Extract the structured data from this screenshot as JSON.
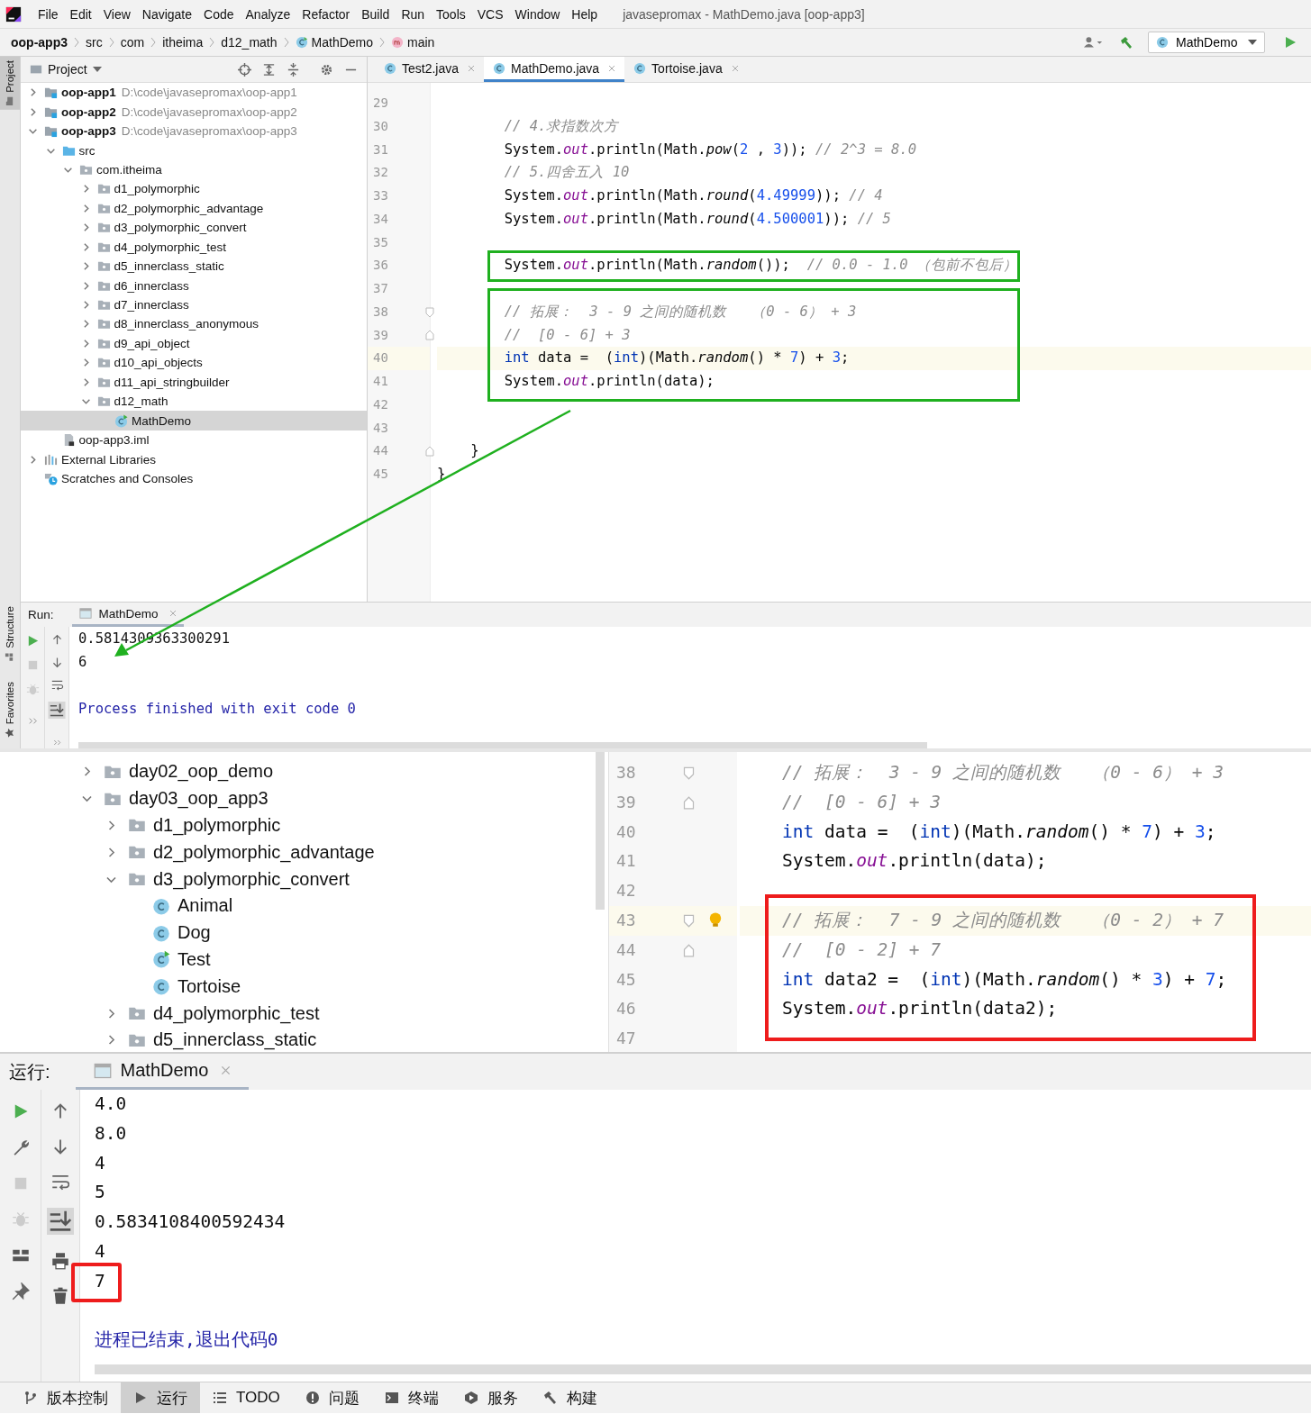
{
  "menubar": {
    "items": [
      "File",
      "Edit",
      "View",
      "Navigate",
      "Code",
      "Analyze",
      "Refactor",
      "Build",
      "Run",
      "Tools",
      "VCS",
      "Window",
      "Help"
    ],
    "title": "javasepromax - MathDemo.java [oop-app3]"
  },
  "breadcrumbs": [
    {
      "label": "oop-app3",
      "kind": "module"
    },
    {
      "label": "src",
      "kind": "plain"
    },
    {
      "label": "com",
      "kind": "plain"
    },
    {
      "label": "itheima",
      "kind": "plain"
    },
    {
      "label": "d12_math",
      "kind": "plain"
    },
    {
      "label": "MathDemo",
      "kind": "class"
    },
    {
      "label": "main",
      "kind": "method"
    }
  ],
  "run_config": "MathDemo",
  "left_strip": {
    "project": "Project",
    "structure": "Structure",
    "favorites": "Favorites"
  },
  "project_panel": {
    "title": "Project",
    "tree": [
      {
        "label": "oop-app1",
        "path": "D:\\code\\javasepromax\\oop-app1",
        "kind": "module",
        "expanded": false,
        "selected": false
      },
      {
        "label": "oop-app2",
        "path": "D:\\code\\javasepromax\\oop-app2",
        "kind": "module",
        "expanded": false,
        "selected": false
      },
      {
        "label": "oop-app3",
        "path": "D:\\code\\javasepromax\\oop-app3",
        "kind": "module",
        "expanded": true,
        "selected": false,
        "children": [
          {
            "label": "src",
            "kind": "source",
            "expanded": true,
            "selected": false,
            "children": [
              {
                "label": "com.itheima",
                "kind": "package",
                "expanded": true,
                "selected": false,
                "children": [
                  {
                    "label": "d1_polymorphic",
                    "kind": "package",
                    "expanded": false,
                    "selected": false
                  },
                  {
                    "label": "d2_polymorphic_advantage",
                    "kind": "package",
                    "expanded": false,
                    "selected": false
                  },
                  {
                    "label": "d3_polymorphic_convert",
                    "kind": "package",
                    "expanded": false,
                    "selected": false
                  },
                  {
                    "label": "d4_polymorphic_test",
                    "kind": "package",
                    "expanded": false,
                    "selected": false
                  },
                  {
                    "label": "d5_innerclass_static",
                    "kind": "package",
                    "expanded": false,
                    "selected": false
                  },
                  {
                    "label": "d6_innerclass",
                    "kind": "package",
                    "expanded": false,
                    "selected": false
                  },
                  {
                    "label": "d7_innerclass",
                    "kind": "package",
                    "expanded": false,
                    "selected": false
                  },
                  {
                    "label": "d8_innerclass_anonymous",
                    "kind": "package",
                    "expanded": false,
                    "selected": false
                  },
                  {
                    "label": "d9_api_object",
                    "kind": "package",
                    "expanded": false,
                    "selected": false
                  },
                  {
                    "label": "d10_api_objects",
                    "kind": "package",
                    "expanded": false,
                    "selected": false
                  },
                  {
                    "label": "d11_api_stringbuilder",
                    "kind": "package",
                    "expanded": false,
                    "selected": false
                  },
                  {
                    "label": "d12_math",
                    "kind": "package",
                    "expanded": true,
                    "selected": false,
                    "children": [
                      {
                        "label": "MathDemo",
                        "kind": "class_main",
                        "selected": true
                      }
                    ]
                  }
                ]
              }
            ]
          },
          {
            "label": "oop-app3.iml",
            "kind": "file",
            "selected": false
          }
        ]
      },
      {
        "label": "External Libraries",
        "kind": "library",
        "expanded": false,
        "selected": false
      },
      {
        "label": "Scratches and Consoles",
        "kind": "scratches",
        "selected": false
      }
    ]
  },
  "editor": {
    "tabs": [
      {
        "label": "Test2.java",
        "selected": false
      },
      {
        "label": "MathDemo.java",
        "selected": true
      },
      {
        "label": "Tortoise.java",
        "selected": false
      }
    ],
    "blocks": [
      {
        "boxed": false,
        "lines": [
          {
            "number": "29"
          },
          {
            "number": "30",
            "tokens": [
              {
                "kind": "comment",
                "text": "        // 4.求指数次方"
              }
            ]
          },
          {
            "number": "31",
            "tokens": [
              {
                "kind": "plain",
                "text": "        System."
              },
              {
                "kind": "field",
                "text": "out"
              },
              {
                "kind": "plain",
                "text": ".println(Math."
              },
              {
                "kind": "method",
                "text": "pow"
              },
              {
                "kind": "plain",
                "text": "("
              },
              {
                "kind": "number",
                "text": "2"
              },
              {
                "kind": "plain",
                "text": " , "
              },
              {
                "kind": "number",
                "text": "3"
              },
              {
                "kind": "plain",
                "text": ")); "
              },
              {
                "kind": "comment",
                "text": "// 2^3 = 8.0"
              }
            ]
          },
          {
            "number": "32",
            "tokens": [
              {
                "kind": "comment",
                "text": "        // 5.四舍五入 10"
              }
            ]
          },
          {
            "number": "33",
            "tokens": [
              {
                "kind": "plain",
                "text": "        System."
              },
              {
                "kind": "field",
                "text": "out"
              },
              {
                "kind": "plain",
                "text": ".println(Math."
              },
              {
                "kind": "method",
                "text": "round"
              },
              {
                "kind": "plain",
                "text": "("
              },
              {
                "kind": "number",
                "text": "4.49999"
              },
              {
                "kind": "plain",
                "text": ")); "
              },
              {
                "kind": "comment",
                "text": "// 4"
              }
            ]
          },
          {
            "number": "34",
            "tokens": [
              {
                "kind": "plain",
                "text": "        System."
              },
              {
                "kind": "field",
                "text": "out"
              },
              {
                "kind": "plain",
                "text": ".println(Math."
              },
              {
                "kind": "method",
                "text": "round"
              },
              {
                "kind": "plain",
                "text": "("
              },
              {
                "kind": "number",
                "text": "4.500001"
              },
              {
                "kind": "plain",
                "text": ")); "
              },
              {
                "kind": "comment",
                "text": "// 5"
              }
            ]
          },
          {
            "number": "35"
          }
        ]
      },
      {
        "boxed": true,
        "lines": [
          {
            "number": "36",
            "tokens": [
              {
                "kind": "plain",
                "text": "        System."
              },
              {
                "kind": "field",
                "text": "out"
              },
              {
                "kind": "plain",
                "text": ".println(Math."
              },
              {
                "kind": "method",
                "text": "random"
              },
              {
                "kind": "plain",
                "text": "());  "
              },
              {
                "kind": "comment",
                "text": "// 0.0 - 1.0 （包前不包后）"
              }
            ]
          }
        ]
      },
      {
        "boxed": false,
        "lines": [
          {
            "number": "37"
          }
        ]
      },
      {
        "boxed": true,
        "lines": [
          {
            "number": "38",
            "fold_start": true,
            "tokens": [
              {
                "kind": "comment",
                "text": "        // 拓展：  3 - 9 之间的随机数   （0 - 6） + 3"
              }
            ]
          },
          {
            "number": "39",
            "fold_end": true,
            "tokens": [
              {
                "kind": "comment",
                "text": "        //  [0 - 6] + 3"
              }
            ]
          },
          {
            "number": "40",
            "current": true,
            "tokens": [
              {
                "kind": "keyword",
                "text": "        int"
              },
              {
                "kind": "plain",
                "text": " data =  ("
              },
              {
                "kind": "keyword",
                "text": "int"
              },
              {
                "kind": "plain",
                "text": ")(Math."
              },
              {
                "kind": "method",
                "text": "random"
              },
              {
                "kind": "plain",
                "text": "() * "
              },
              {
                "kind": "number",
                "text": "7"
              },
              {
                "kind": "plain",
                "text": ") + "
              },
              {
                "kind": "number",
                "text": "3"
              },
              {
                "kind": "plain",
                "text": ";"
              }
            ]
          },
          {
            "number": "41",
            "tokens": [
              {
                "kind": "plain",
                "text": "        System."
              },
              {
                "kind": "field",
                "text": "out"
              },
              {
                "kind": "plain",
                "text": ".println(data);"
              }
            ]
          }
        ]
      },
      {
        "boxed": false,
        "lines": [
          {
            "number": "42"
          },
          {
            "number": "43"
          },
          {
            "number": "44",
            "fold_end": true,
            "tokens": [
              {
                "kind": "plain",
                "text": "    }"
              }
            ]
          },
          {
            "number": "45",
            "tokens": [
              {
                "kind": "plain",
                "text": "}"
              }
            ]
          }
        ]
      }
    ]
  },
  "run_panel": {
    "label": "Run:",
    "tab": "MathDemo",
    "output": [
      {
        "kind": "stdout",
        "text": "0.5814309363300291"
      },
      {
        "kind": "stdout",
        "text": "6"
      },
      {
        "kind": "exit",
        "text": "Process finished with exit code 0"
      }
    ]
  },
  "second_view": {
    "tree": [
      {
        "label": "day02_oop_demo",
        "kind": "package",
        "expanded": false,
        "selected": false
      },
      {
        "label": "day03_oop_app3",
        "kind": "package",
        "expanded": true,
        "selected": false,
        "children": [
          {
            "label": "d1_polymorphic",
            "kind": "package",
            "expanded": false,
            "selected": false
          },
          {
            "label": "d2_polymorphic_advantage",
            "kind": "package",
            "expanded": false,
            "selected": false
          },
          {
            "label": "d3_polymorphic_convert",
            "kind": "package",
            "expanded": true,
            "selected": false,
            "children": [
              {
                "label": "Animal",
                "kind": "class",
                "selected": false
              },
              {
                "label": "Dog",
                "kind": "class",
                "selected": false
              },
              {
                "label": "Test",
                "kind": "class_main",
                "selected": false
              },
              {
                "label": "Tortoise",
                "kind": "class",
                "selected": false
              }
            ]
          },
          {
            "label": "d4_polymorphic_test",
            "kind": "package",
            "expanded": false,
            "selected": false
          },
          {
            "label": "d5_innerclass_static",
            "kind": "package",
            "expanded": false,
            "selected": false
          }
        ]
      }
    ],
    "blocks": [
      {
        "boxed": false,
        "lines": [
          {
            "number": "38",
            "fold_start": true,
            "tokens": [
              {
                "kind": "comment",
                "text": "    // 拓展：  3 - 9 之间的随机数   （0 - 6） + 3"
              }
            ]
          },
          {
            "number": "39",
            "fold_end": true,
            "tokens": [
              {
                "kind": "comment",
                "text": "    //  [0 - 6] + 3"
              }
            ]
          },
          {
            "number": "40",
            "tokens": [
              {
                "kind": "keyword",
                "text": "    int"
              },
              {
                "kind": "plain",
                "text": " data =  ("
              },
              {
                "kind": "keyword",
                "text": "int"
              },
              {
                "kind": "plain",
                "text": ")(Math."
              },
              {
                "kind": "method",
                "text": "random"
              },
              {
                "kind": "plain",
                "text": "() * "
              },
              {
                "kind": "number",
                "text": "7"
              },
              {
                "kind": "plain",
                "text": ") + "
              },
              {
                "kind": "number",
                "text": "3"
              },
              {
                "kind": "plain",
                "text": ";"
              }
            ]
          },
          {
            "number": "41",
            "tokens": [
              {
                "kind": "plain",
                "text": "    System."
              },
              {
                "kind": "field",
                "text": "out"
              },
              {
                "kind": "plain",
                "text": ".println(data);"
              }
            ]
          },
          {
            "number": "42"
          }
        ]
      },
      {
        "boxed": true,
        "lines": [
          {
            "number": "43",
            "fold_start": true,
            "current": true,
            "bulb": true,
            "tokens": [
              {
                "kind": "comment",
                "text": "    // 拓展：  7 - 9 之间的随机数   （0 - 2） + 7"
              }
            ]
          },
          {
            "number": "44",
            "fold_end": true,
            "tokens": [
              {
                "kind": "comment",
                "text": "    //  [0 - 2] + 7"
              }
            ]
          },
          {
            "number": "45",
            "tokens": [
              {
                "kind": "keyword",
                "text": "    int"
              },
              {
                "kind": "plain",
                "text": " data2 =  ("
              },
              {
                "kind": "keyword",
                "text": "int"
              },
              {
                "kind": "plain",
                "text": ")(Math."
              },
              {
                "kind": "method",
                "text": "random"
              },
              {
                "kind": "plain",
                "text": "() * "
              },
              {
                "kind": "number",
                "text": "3"
              },
              {
                "kind": "plain",
                "text": ") + "
              },
              {
                "kind": "number",
                "text": "7"
              },
              {
                "kind": "plain",
                "text": ";"
              }
            ]
          },
          {
            "number": "46",
            "tokens": [
              {
                "kind": "plain",
                "text": "    System."
              },
              {
                "kind": "field",
                "text": "out"
              },
              {
                "kind": "plain",
                "text": ".println(data2);"
              }
            ]
          }
        ]
      },
      {
        "boxed": false,
        "lines": [
          {
            "number": "47"
          }
        ]
      }
    ],
    "run_panel": {
      "label": "运行:",
      "tab": "MathDemo",
      "output": [
        {
          "kind": "stdout",
          "text": "4.0"
        },
        {
          "kind": "stdout",
          "text": "8.0"
        },
        {
          "kind": "stdout",
          "text": "4"
        },
        {
          "kind": "stdout",
          "text": "5"
        },
        {
          "kind": "stdout",
          "text": "0.5834108400592434"
        },
        {
          "kind": "stdout",
          "text": "4"
        },
        {
          "kind": "stdout",
          "text": "7",
          "boxed": true
        },
        {
          "kind": "exit",
          "text": "进程已结束,退出代码0"
        }
      ]
    }
  },
  "tool_windows": [
    {
      "label": "版本控制",
      "kind": "vcs",
      "selected": false
    },
    {
      "label": "运行",
      "kind": "run",
      "selected": true
    },
    {
      "label": "TODO",
      "kind": "todo",
      "selected": false
    },
    {
      "label": "问题",
      "kind": "problems",
      "selected": false
    },
    {
      "label": "终端",
      "kind": "terminal",
      "selected": false
    },
    {
      "label": "服务",
      "kind": "services",
      "selected": false
    },
    {
      "label": "构建",
      "kind": "build",
      "selected": false
    }
  ]
}
